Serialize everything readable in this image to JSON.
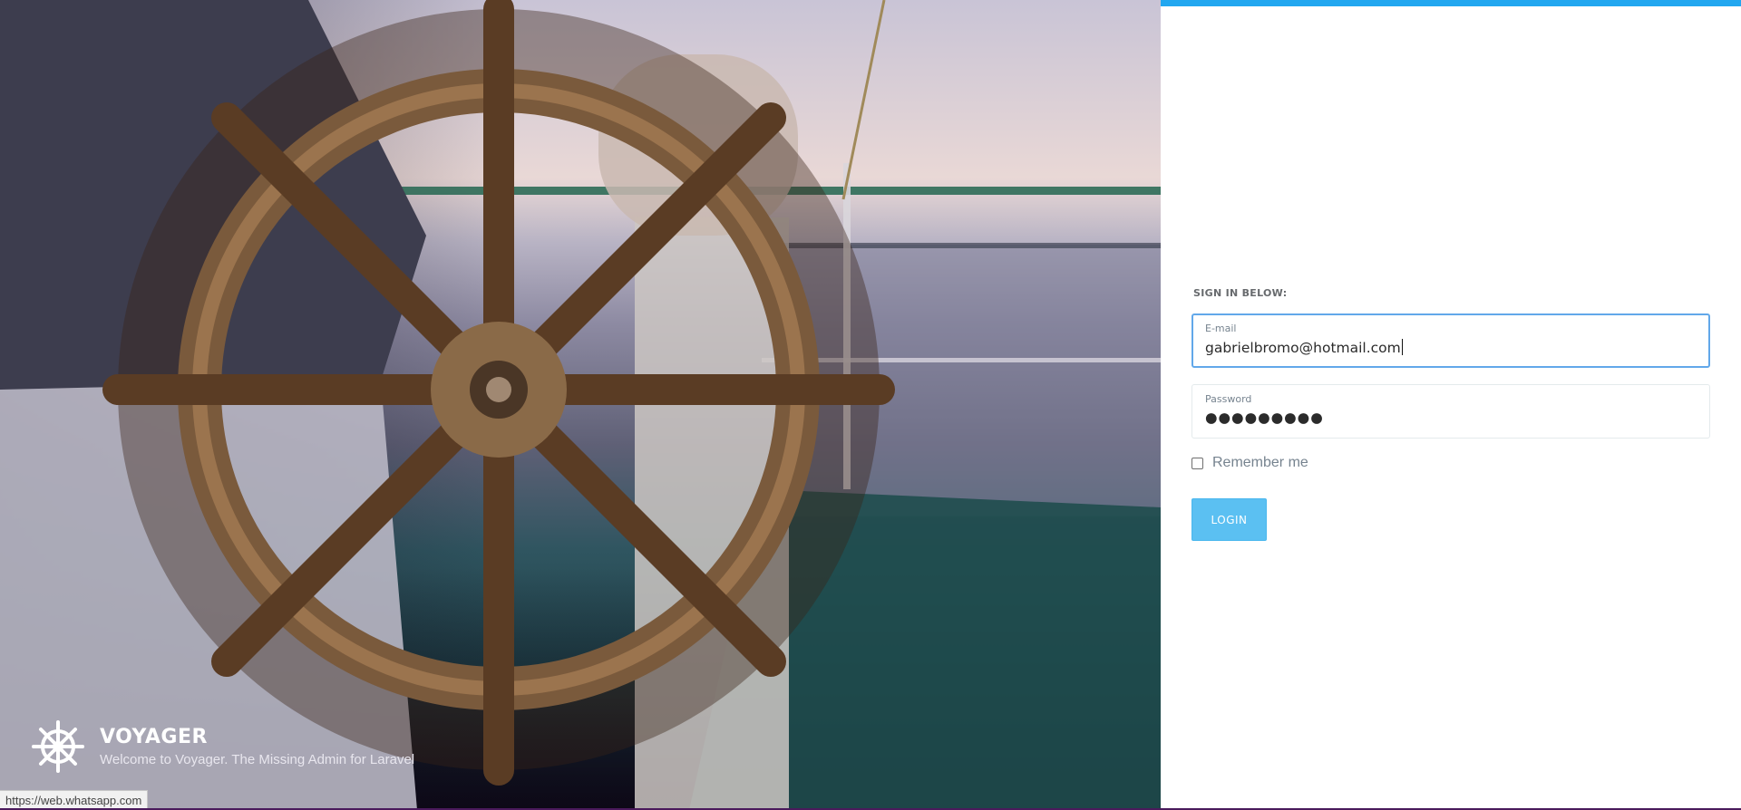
{
  "hero": {
    "brand_name": "VOYAGER",
    "tagline": "Welcome to Voyager. The Missing Admin for Laravel",
    "logo_icon": "ship-wheel-icon"
  },
  "status_bar": {
    "url": "https://web.whatsapp.com"
  },
  "login_form": {
    "heading": "SIGN IN BELOW:",
    "email": {
      "label": "E-mail",
      "value": "gabrielbromo@hotmail.com"
    },
    "password": {
      "label": "Password",
      "masked_value": "●●●●●●●●●"
    },
    "remember_label": "Remember me",
    "remember_checked": false,
    "login_button": "LOGIN"
  },
  "colors": {
    "accent": "#22a7f0",
    "button": "#5bc0f2",
    "focus_border": "#62a8ea"
  }
}
